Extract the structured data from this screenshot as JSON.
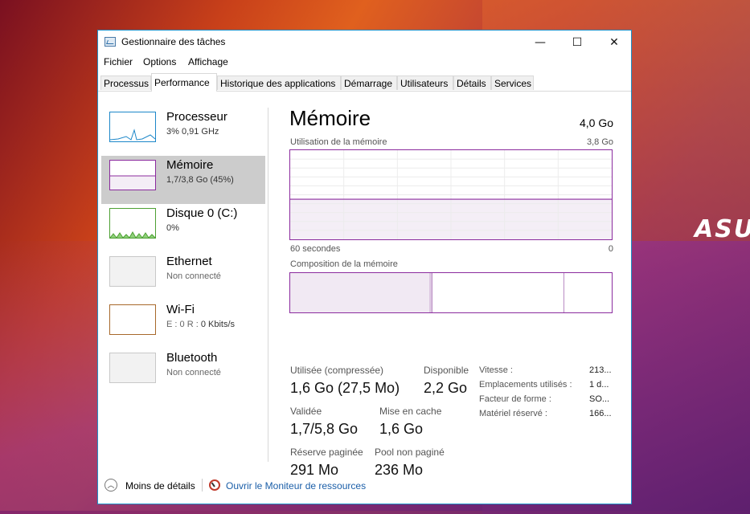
{
  "window": {
    "title": "Gestionnaire des tâches",
    "controls": {
      "minimize": "—",
      "maximize": "☐",
      "close": "✕"
    }
  },
  "menu": [
    "Fichier",
    "Options",
    "Affichage"
  ],
  "tabs": [
    "Processus",
    "Performance",
    "Historique des applications",
    "Démarrage",
    "Utilisateurs",
    "Détails",
    "Services"
  ],
  "active_tab": "Performance",
  "sidebar": [
    {
      "name": "Processeur",
      "sub": "3%  0,91 GHz",
      "color": "#1c87c9"
    },
    {
      "name": "Mémoire",
      "sub": "1,7/3,8 Go (45%)",
      "color": "#8b2b9e",
      "selected": true
    },
    {
      "name": "Disque 0 (C:)",
      "sub": "0%",
      "color": "#4da033"
    },
    {
      "name": "Ethernet",
      "sub": "Non connecté",
      "color": "#a0a0a0"
    },
    {
      "name": "Wi-Fi",
      "sub_parts": [
        "E :",
        "0",
        "R :",
        "0 Kbits/s"
      ],
      "color": "#a7682a"
    },
    {
      "name": "Bluetooth",
      "sub": "Non connecté",
      "color": "#a0a0a0"
    }
  ],
  "main": {
    "title": "Mémoire",
    "total": "4,0 Go",
    "usage_caption": "Utilisation de la mémoire",
    "usage_max": "3,8 Go",
    "time_left": "60 secondes",
    "time_right": "0",
    "composition_caption": "Composition de la mémoire",
    "usage_fraction": 0.45
  },
  "stats": {
    "used_label": "Utilisée (compressée)",
    "used_value": "1,6 Go (27,5 Mo)",
    "available_label": "Disponible",
    "available_value": "2,2 Go",
    "committed_label": "Validée",
    "committed_value": "1,7/5,8 Go",
    "cached_label": "Mise en cache",
    "cached_value": "1,6 Go",
    "paged_label": "Réserve paginée",
    "paged_value": "291 Mo",
    "nonpaged_label": "Pool non paginé",
    "nonpaged_value": "236 Mo"
  },
  "specs": [
    {
      "label": "Vitesse :",
      "value": "213..."
    },
    {
      "label": "Emplacements utilisés :",
      "value": "1 d..."
    },
    {
      "label": "Facteur de forme :",
      "value": "SO..."
    },
    {
      "label": "Matériel réservé :",
      "value": "166..."
    }
  ],
  "footer": {
    "fewer_details": "Moins de détails",
    "resource_monitor": "Ouvrir le Moniteur de ressources"
  },
  "desktop": {
    "brand": "ASUS"
  }
}
